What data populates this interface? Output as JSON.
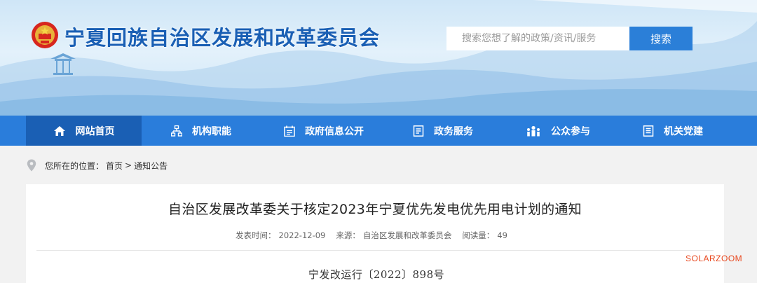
{
  "header": {
    "site_title": "宁夏回族自治区发展和改革委员会",
    "search_placeholder": "搜索您想了解的政策/资讯/服务",
    "search_button": "搜索"
  },
  "nav": {
    "items": [
      {
        "label": "网站首页",
        "icon": "home-icon"
      },
      {
        "label": "机构职能",
        "icon": "org-chart-icon"
      },
      {
        "label": "政府信息公开",
        "icon": "calendar-doc-icon"
      },
      {
        "label": "政务服务",
        "icon": "document-list-icon"
      },
      {
        "label": "公众参与",
        "icon": "people-icon"
      },
      {
        "label": "机关党建",
        "icon": "notes-icon"
      }
    ]
  },
  "breadcrumb": {
    "prefix": "您所在的位置：",
    "home": "首页",
    "separator": ">",
    "current": "通知公告"
  },
  "article": {
    "title": "自治区发展改革委关于核定2023年宁夏优先发电优先用电计划的通知",
    "publish_label": "发表时间：",
    "publish_date": "2022-12-09",
    "source_label": "来源：",
    "source": "自治区发展和改革委员会",
    "views_label": "阅读量：",
    "views": "49",
    "doc_number": "宁发改运行〔2022〕898号"
  },
  "watermark": "SOLARZOOM",
  "colors": {
    "nav_bg": "#2a7ddb",
    "nav_active": "#1a5fb4",
    "title_blue": "#1a5fb4",
    "search_btn": "#2b7fd8",
    "watermark": "#e8481f"
  }
}
